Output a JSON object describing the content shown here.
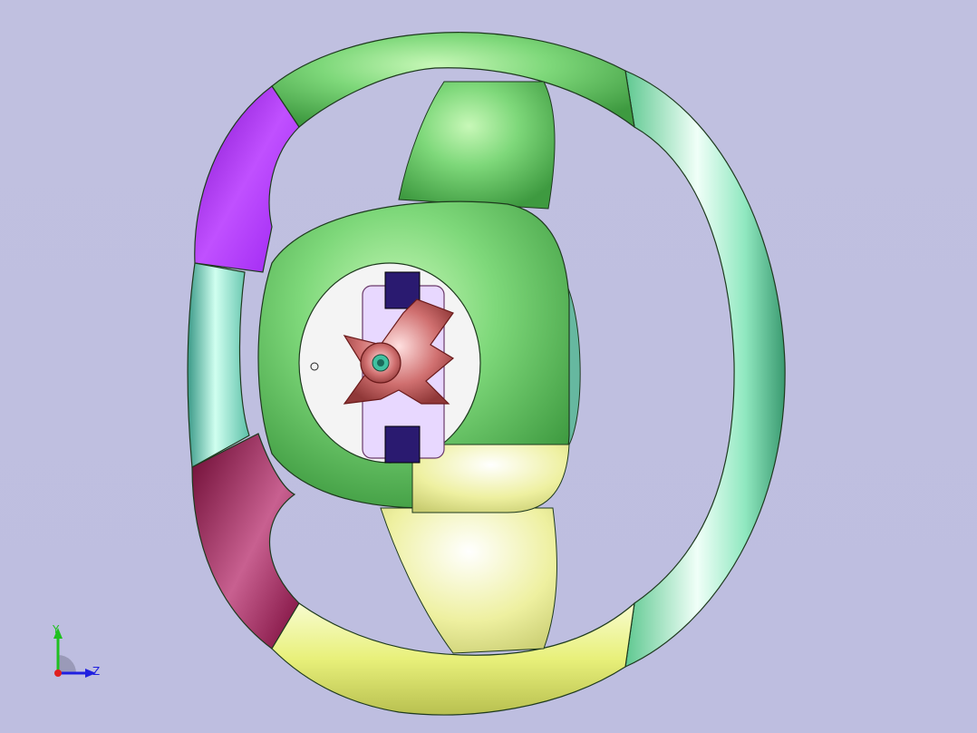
{
  "viewport": {
    "background": "#bfbfe0"
  },
  "model": {
    "colors": {
      "rim_top": "#7ed87a",
      "rim_left_upper": "#a020f0",
      "rim_left_mid": "#6fd8c0",
      "rim_left_lower": "#7a0a3a",
      "rim_bottom": "#e8f07a",
      "rim_right": "#7ee8b0",
      "hub_green": "#7bd46c",
      "hub_yellow": "#eef0a0",
      "cover_white": "#f4f4f4",
      "mechanism": "#d07070",
      "connector": "#2a1a70",
      "edge": "#1e3a1e"
    }
  },
  "triad": {
    "y_label": "Y",
    "z_label": "Z",
    "colors": {
      "y": "#20c020",
      "z": "#2020e0",
      "x": "#e02020"
    }
  }
}
